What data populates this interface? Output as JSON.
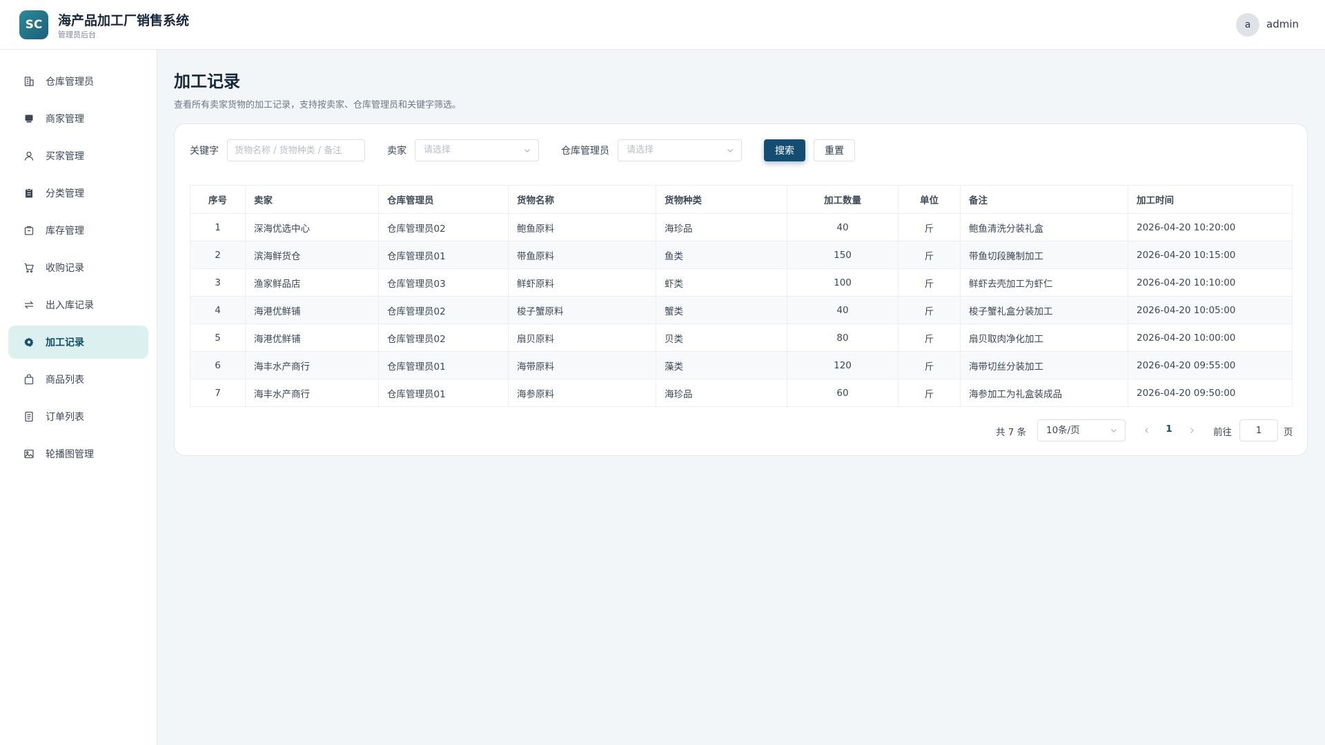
{
  "header": {
    "logo_text": "SC",
    "title": "海产品加工厂销售系统",
    "subtitle": "管理员后台",
    "avatar_letter": "a",
    "username": "admin"
  },
  "sidebar": {
    "items": [
      {
        "label": "仓库管理员",
        "icon": "building-icon"
      },
      {
        "label": "商家管理",
        "icon": "store-icon"
      },
      {
        "label": "买家管理",
        "icon": "user-icon"
      },
      {
        "label": "分类管理",
        "icon": "clipboard-icon"
      },
      {
        "label": "库存管理",
        "icon": "box-icon"
      },
      {
        "label": "收购记录",
        "icon": "cart-icon"
      },
      {
        "label": "出入库记录",
        "icon": "transfer-icon"
      },
      {
        "label": "加工记录",
        "icon": "gear-icon",
        "active": true
      },
      {
        "label": "商品列表",
        "icon": "bag-icon"
      },
      {
        "label": "订单列表",
        "icon": "document-icon"
      },
      {
        "label": "轮播图管理",
        "icon": "image-icon"
      }
    ]
  },
  "page": {
    "title": "加工记录",
    "description": "查看所有卖家货物的加工记录，支持按卖家、仓库管理员和关键字筛选。"
  },
  "filters": {
    "keyword_label": "关键字",
    "keyword_value": "",
    "keyword_placeholder": "货物名称 / 货物种类 / 备注",
    "seller_label": "卖家",
    "seller_placeholder": "请选择",
    "manager_label": "仓库管理员",
    "manager_placeholder": "请选择",
    "search_button": "搜索",
    "reset_button": "重置"
  },
  "table": {
    "columns": [
      "序号",
      "卖家",
      "仓库管理员",
      "货物名称",
      "货物种类",
      "加工数量",
      "单位",
      "备注",
      "加工时间"
    ],
    "rows": [
      [
        "1",
        "深海优选中心",
        "仓库管理员02",
        "鲍鱼原料",
        "海珍品",
        "40",
        "斤",
        "鲍鱼清洗分装礼盒",
        "2026-04-20 10:20:00"
      ],
      [
        "2",
        "滨海鲜货仓",
        "仓库管理员01",
        "带鱼原料",
        "鱼类",
        "150",
        "斤",
        "带鱼切段腌制加工",
        "2026-04-20 10:15:00"
      ],
      [
        "3",
        "渔家鲜品店",
        "仓库管理员03",
        "鲜虾原料",
        "虾类",
        "100",
        "斤",
        "鲜虾去壳加工为虾仁",
        "2026-04-20 10:10:00"
      ],
      [
        "4",
        "海港优鲜铺",
        "仓库管理员02",
        "梭子蟹原料",
        "蟹类",
        "40",
        "斤",
        "梭子蟹礼盒分装加工",
        "2026-04-20 10:05:00"
      ],
      [
        "5",
        "海港优鲜铺",
        "仓库管理员02",
        "扇贝原料",
        "贝类",
        "80",
        "斤",
        "扇贝取肉净化加工",
        "2026-04-20 10:00:00"
      ],
      [
        "6",
        "海丰水产商行",
        "仓库管理员01",
        "海带原料",
        "藻类",
        "120",
        "斤",
        "海带切丝分装加工",
        "2026-04-20 09:55:00"
      ],
      [
        "7",
        "海丰水产商行",
        "仓库管理员01",
        "海参原料",
        "海珍品",
        "60",
        "斤",
        "海参加工为礼盒装成品",
        "2026-04-20 09:50:00"
      ]
    ]
  },
  "pagination": {
    "total_text": "共 7 条",
    "page_size": "10条/页",
    "current_page": "1",
    "goto_label": "前往",
    "goto_value": "1",
    "page_suffix": "页"
  },
  "colors": {
    "primary": "#154d72",
    "active_nav_bg": "#dcf0f0",
    "logo_gradient": "#2c8a9a",
    "page_bg": "#f3f6f9"
  }
}
